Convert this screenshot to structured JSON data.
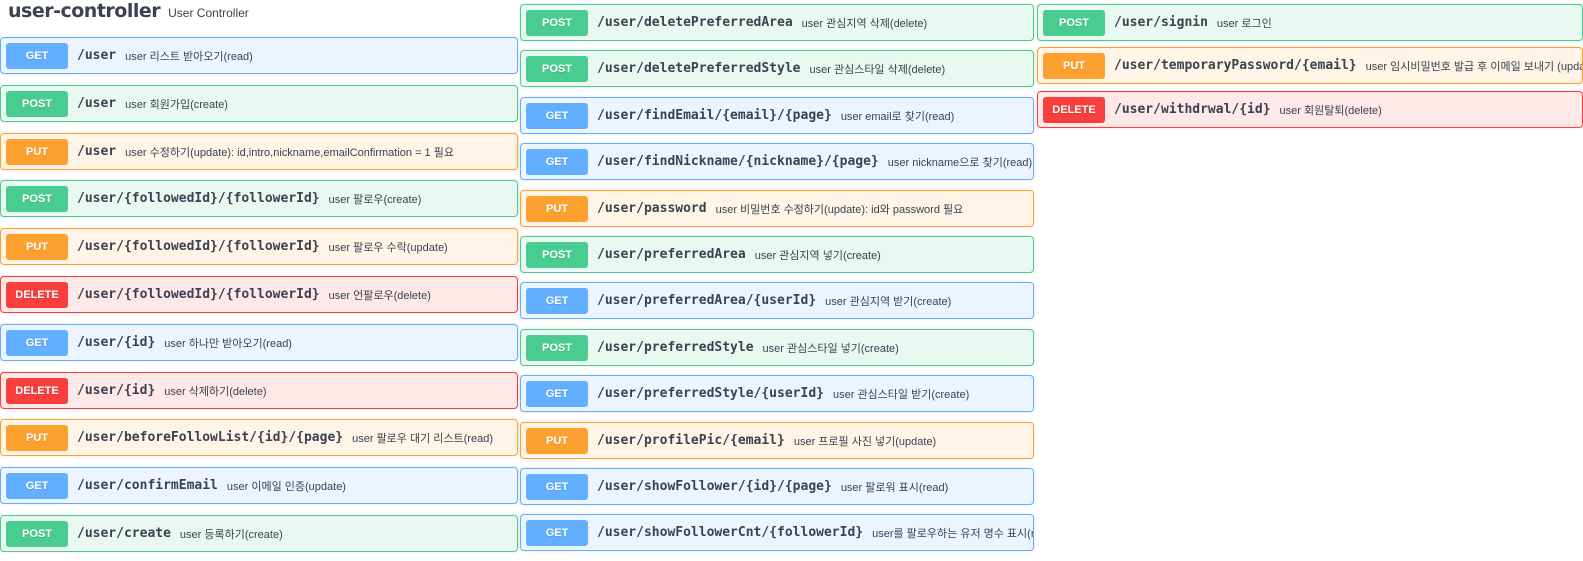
{
  "controller": {
    "name": "user-controller",
    "description": "User Controller"
  },
  "colors": {
    "get": "#61affe",
    "post": "#49cc90",
    "put": "#fca130",
    "delete": "#f93e3e"
  },
  "columns": [
    [
      {
        "method": "GET",
        "path": "/user",
        "desc": "user 리스트 받아오기(read)"
      },
      {
        "method": "POST",
        "path": "/user",
        "desc": "user 회원가입(create)"
      },
      {
        "method": "PUT",
        "path": "/user",
        "desc": "user 수정하기(update): id,intro,nickname,emailConfirmation = 1 필요"
      },
      {
        "method": "POST",
        "path": "/user/{followedId}/{followerId}",
        "desc": "user 팔로우(create)"
      },
      {
        "method": "PUT",
        "path": "/user/{followedId}/{followerId}",
        "desc": "user 팔로우 수락(update)"
      },
      {
        "method": "DELETE",
        "path": "/user/{followedId}/{followerId}",
        "desc": "user 언팔로우(delete)"
      },
      {
        "method": "GET",
        "path": "/user/{id}",
        "desc": "user 하나만 받아오기(read)"
      },
      {
        "method": "DELETE",
        "path": "/user/{id}",
        "desc": "user 삭제하기(delete)"
      },
      {
        "method": "PUT",
        "path": "/user/beforeFollowList/{id}/{page}",
        "desc": "user 팔로우 대기 리스트(read)"
      },
      {
        "method": "GET",
        "path": "/user/confirmEmail",
        "desc": "user 이메일 인증(update)"
      },
      {
        "method": "POST",
        "path": "/user/create",
        "desc": "user 등록하기(create)"
      }
    ],
    [
      {
        "method": "POST",
        "path": "/user/deletePreferredArea",
        "desc": "user 관심지역 삭제(delete)"
      },
      {
        "method": "POST",
        "path": "/user/deletePreferredStyle",
        "desc": "user 관심스타일 삭제(delete)"
      },
      {
        "method": "GET",
        "path": "/user/findEmail/{email}/{page}",
        "desc": "user email로 찾기(read)"
      },
      {
        "method": "GET",
        "path": "/user/findNickname/{nickname}/{page}",
        "desc": "user nickname으로 찾기(read)"
      },
      {
        "method": "PUT",
        "path": "/user/password",
        "desc": "user 비밀번호 수정하기(update): id와 password 필요"
      },
      {
        "method": "POST",
        "path": "/user/preferredArea",
        "desc": "user 관심지역 넣기(create)"
      },
      {
        "method": "GET",
        "path": "/user/preferredArea/{userId}",
        "desc": "user 관심지역 받기(create)"
      },
      {
        "method": "POST",
        "path": "/user/preferredStyle",
        "desc": "user 관심스타일 넣기(create)"
      },
      {
        "method": "GET",
        "path": "/user/preferredStyle/{userId}",
        "desc": "user 관심스타일 받기(create)"
      },
      {
        "method": "PUT",
        "path": "/user/profilePic/{email}",
        "desc": "user 프로필 사진 넣기(update)"
      },
      {
        "method": "GET",
        "path": "/user/showFollower/{id}/{page}",
        "desc": "user 팔로워 표시(read)"
      },
      {
        "method": "GET",
        "path": "/user/showFollowerCnt/{followerId}",
        "desc": "user를 팔로우하는 유저 명수 표시(read)"
      }
    ],
    [
      {
        "method": "POST",
        "path": "/user/signin",
        "desc": "user 로그인"
      },
      {
        "method": "PUT",
        "path": "/user/temporaryPassword/{email}",
        "desc": "user 임시비밀번호 발급 후 이메일 보내기 (update)"
      },
      {
        "method": "DELETE",
        "path": "/user/withdrwal/{id}",
        "desc": "user 회원탈퇴(delete)"
      }
    ]
  ]
}
